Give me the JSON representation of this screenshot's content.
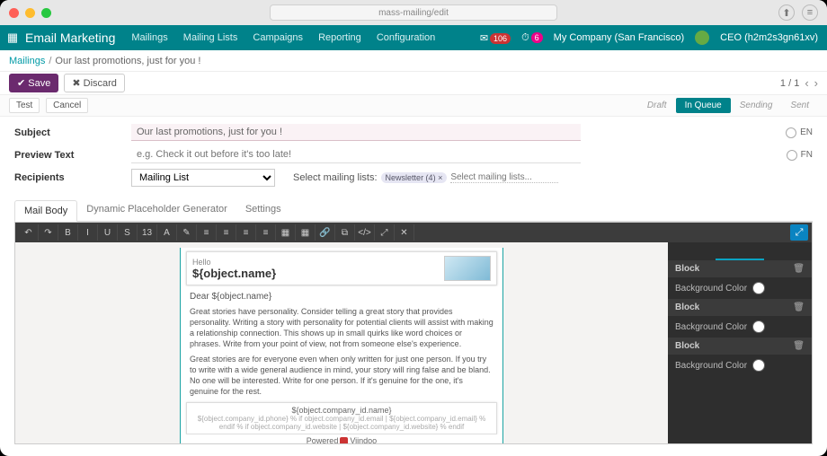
{
  "browser": {
    "url_placeholder": "mass-mailing/edit"
  },
  "appbar": {
    "title": "Email Marketing",
    "menu": [
      "Mailings",
      "Mailing Lists",
      "Campaigns",
      "Reporting",
      "Configuration"
    ],
    "msg_badge": "106",
    "act_badge": "6",
    "company": "My Company (San Francisco)",
    "user": "CEO (h2m2s3gn61xv)"
  },
  "breadcrumb": {
    "root": "Mailings",
    "current": "Our last promotions, just for you !"
  },
  "actions": {
    "save": "Save",
    "discard": "Discard",
    "pager": "1 / 1"
  },
  "statusbar": {
    "left": [
      "Test",
      "Cancel"
    ],
    "stages": [
      "Draft",
      "In Queue",
      "Sending",
      "Sent"
    ],
    "active_stage": 1
  },
  "form": {
    "subject_label": "Subject",
    "subject_value": "Our last promotions, just for you !",
    "preview_label": "Preview Text",
    "preview_placeholder": "e.g. Check it out before it's too late!",
    "recipients_label": "Recipients",
    "recipients_value": "Mailing List",
    "select_ml_label": "Select mailing lists:",
    "ml_tag": "Newsletter (4)",
    "ml_placeholder": "Select mailing lists...",
    "lang1": "EN",
    "lang2": "FN"
  },
  "tabs": [
    "Mail Body",
    "Dynamic Placeholder Generator",
    "Settings"
  ],
  "toolbar_icons": [
    "↶",
    "↷",
    "B",
    "I",
    "U",
    "S",
    "13",
    "A",
    "✎",
    "≡",
    "≡",
    "≡",
    "≡",
    "▦",
    "▦",
    "🔗",
    "⧉",
    "</>",
    "⤢",
    "✕"
  ],
  "mail": {
    "hello": "Hello",
    "name_var": "${object.name}",
    "dear": "Dear ${object.name}",
    "p1": "Great stories have personality. Consider telling a great story that provides personality. Writing a story with personality for potential clients will assist with making a relationship connection. This shows up in small quirks like word choices or phrases. Write from your point of view, not from someone else's experience.",
    "p2": "Great stories are for everyone even when only written for just one person. If you try to write with a wide general audience in mind, your story will ring false and be bland. No one will be interested. Write for one person. If it's genuine for the one, it's genuine for the rest.",
    "footer_title": "${object.company_id.name}",
    "footer_sub": "${object.company_id.phone} % if object.company_id.email | ${object.company_id.email} % endif % if object.company_id.website | ${object.company_id.website} % endif",
    "powered": "Powered",
    "powered2": "Viindoo"
  },
  "inspector": {
    "block": "Block",
    "bgcolor": "Background Color"
  }
}
